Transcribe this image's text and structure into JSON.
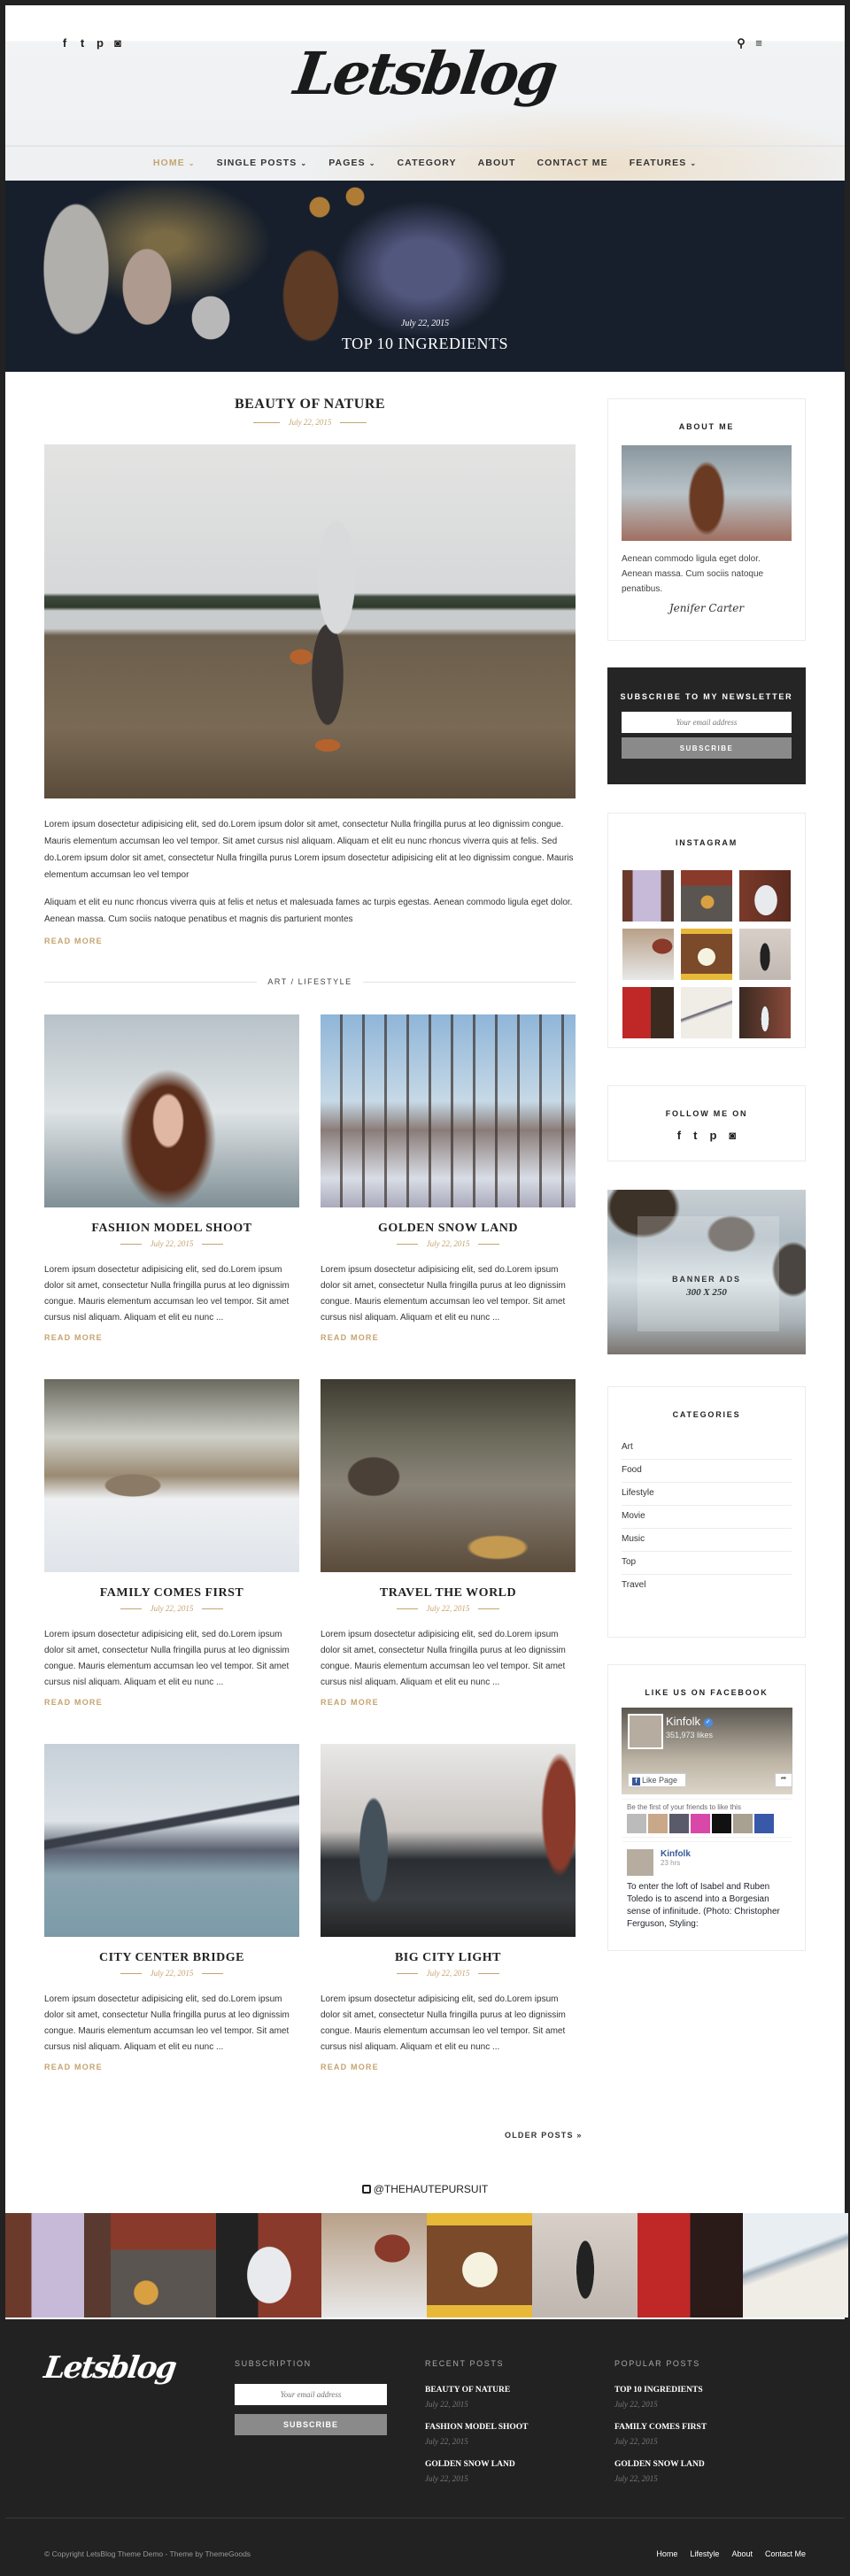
{
  "header": {
    "logo": "Letsblog",
    "social": [
      {
        "icon": "facebook-icon",
        "glyph": "f"
      },
      {
        "icon": "twitter-icon",
        "glyph": "t"
      },
      {
        "icon": "pinterest-icon",
        "glyph": "p"
      },
      {
        "icon": "instagram-icon",
        "glyph": "◙"
      }
    ],
    "search_glyph": "⚲",
    "menu_glyph": "≡",
    "nav": [
      {
        "label": "HOME",
        "dropdown": true,
        "active": true
      },
      {
        "label": "SINGLE POSTS",
        "dropdown": true
      },
      {
        "label": "PAGES",
        "dropdown": true
      },
      {
        "label": "CATEGORY",
        "dropdown": false
      },
      {
        "label": "ABOUT",
        "dropdown": false
      },
      {
        "label": "CONTACT ME",
        "dropdown": false
      },
      {
        "label": "FEATURES",
        "dropdown": true
      }
    ],
    "caret": "⌄"
  },
  "hero": {
    "date": "July 22, 2015",
    "title": "TOP 10 INGREDIENTS"
  },
  "featured": {
    "title": "BEAUTY OF NATURE",
    "date": "July 22, 2015",
    "paragraphs": [
      "Lorem ipsum dosectetur adipisicing elit, sed do.Lorem ipsum dolor sit amet, consectetur Nulla fringilla purus at leo dignissim congue. Mauris elementum accumsan leo vel tempor. Sit amet cursus nisl aliquam. Aliquam et elit eu nunc rhoncus viverra quis at felis. Sed do.Lorem ipsum dolor sit amet, consectetur Nulla fringilla purus Lorem ipsum dosectetur adipisicing elit at leo dignissim congue. Mauris elementum accumsan leo vel tempor",
      "Aliquam et elit eu nunc rhoncus viverra quis at felis et netus et malesuada fames ac turpis egestas. Aenean commodo ligula eget dolor. Aenean massa. Cum sociis natoque penatibus et magnis dis parturient montes"
    ],
    "read_more": "READ MORE",
    "categories": "ART  / LIFESTYLE"
  },
  "posts": [
    {
      "title": "FASHION MODEL SHOOT",
      "date": "July 22, 2015",
      "excerpt": "Lorem ipsum dosectetur adipisicing elit, sed do.Lorem ipsum dolor sit amet, consectetur Nulla fringilla purus at leo dignissim congue. Mauris elementum accumsan leo vel tempor. Sit amet cursus nisl aliquam. Aliquam et elit eu nunc ...",
      "read_more": "READ MORE"
    },
    {
      "title": "GOLDEN SNOW LAND",
      "date": "July 22, 2015",
      "excerpt": "Lorem ipsum dosectetur adipisicing elit, sed do.Lorem ipsum dolor sit amet, consectetur Nulla fringilla purus at leo dignissim congue. Mauris elementum accumsan leo vel tempor. Sit amet cursus nisl aliquam. Aliquam et elit eu nunc ...",
      "read_more": "READ MORE"
    },
    {
      "title": "FAMILY COMES FIRST",
      "date": "July 22, 2015",
      "excerpt": "Lorem ipsum dosectetur adipisicing elit, sed do.Lorem ipsum dolor sit amet, consectetur Nulla fringilla purus at leo dignissim congue. Mauris elementum accumsan leo vel tempor. Sit amet cursus nisl aliquam. Aliquam et elit eu nunc ...",
      "read_more": "READ MORE"
    },
    {
      "title": "TRAVEL THE WORLD",
      "date": "July 22, 2015",
      "excerpt": "Lorem ipsum dosectetur adipisicing elit, sed do.Lorem ipsum dolor sit amet, consectetur Nulla fringilla purus at leo dignissim congue. Mauris elementum accumsan leo vel tempor. Sit amet cursus nisl aliquam. Aliquam et elit eu nunc ...",
      "read_more": "READ MORE"
    },
    {
      "title": "CITY CENTER BRIDGE",
      "date": "July 22, 2015",
      "excerpt": "Lorem ipsum dosectetur adipisicing elit, sed do.Lorem ipsum dolor sit amet, consectetur Nulla fringilla purus at leo dignissim congue. Mauris elementum accumsan leo vel tempor. Sit amet cursus nisl aliquam. Aliquam et elit eu nunc ...",
      "read_more": "READ MORE"
    },
    {
      "title": "BIG CITY LIGHT",
      "date": "July 22, 2015",
      "excerpt": "Lorem ipsum dosectetur adipisicing elit, sed do.Lorem ipsum dolor sit amet, consectetur Nulla fringilla purus at leo dignissim congue. Mauris elementum accumsan leo vel tempor. Sit amet cursus nisl aliquam. Aliquam et elit eu nunc ...",
      "read_more": "READ MORE"
    }
  ],
  "pagination": {
    "older": "OLDER POSTS »"
  },
  "sidebar": {
    "about": {
      "title": "ABOUT ME",
      "text": "Aenean commodo ligula eget dolor. Aenean massa. Cum sociis natoque penatibus.",
      "signature": "Jenifer Carter"
    },
    "newsletter": {
      "title": "SUBSCRIBE TO MY NEWSLETTER",
      "placeholder": "Your email address",
      "button": "SUBSCRIBE"
    },
    "instagram": {
      "title": "INSTAGRAM"
    },
    "follow": {
      "title": "FOLLOW ME ON",
      "icons": [
        {
          "icon": "facebook-icon",
          "glyph": "f"
        },
        {
          "icon": "twitter-icon",
          "glyph": "t"
        },
        {
          "icon": "pinterest-icon",
          "glyph": "p"
        },
        {
          "icon": "instagram-icon",
          "glyph": "◙"
        }
      ]
    },
    "banner": {
      "label": "BANNER ADS",
      "size": "300 X 250"
    },
    "categories": {
      "title": "CATEGORIES",
      "items": [
        "Art",
        "Food",
        "Lifestyle",
        "Movie",
        "Music",
        "Top",
        "Travel"
      ]
    },
    "facebook": {
      "title": "LIKE US ON FACEBOOK",
      "page_name": "Kinfolk",
      "likes": "351,973 likes",
      "like_button": "Like Page",
      "friends_text": "Be the first of your friends to like this",
      "post_name": "Kinfolk",
      "post_time": "23 hrs",
      "post_text": "To enter the loft of Isabel and Ruben Toledo is to ascend into a Borgesian sense of infinitude. (Photo: Christopher Ferguson, Styling:"
    }
  },
  "instagram_strip": {
    "handle": "@THEHAUTEPURSUIT"
  },
  "footer": {
    "logo": "Letsblog",
    "subscription": {
      "title": "SUBSCRIPTION",
      "placeholder": "Your email address",
      "button": "SUBSCRIBE"
    },
    "recent": {
      "title": "RECENT POSTS",
      "items": [
        {
          "title": "BEAUTY OF NATURE",
          "date": "July 22, 2015"
        },
        {
          "title": "FASHION MODEL SHOOT",
          "date": "July 22, 2015"
        },
        {
          "title": "GOLDEN SNOW LAND",
          "date": "July 22, 2015"
        }
      ]
    },
    "popular": {
      "title": "POPULAR POSTS",
      "items": [
        {
          "title": "TOP 10 INGREDIENTS",
          "date": "July 22, 2015"
        },
        {
          "title": "FAMILY COMES FIRST",
          "date": "July 22, 2015"
        },
        {
          "title": "GOLDEN SNOW LAND",
          "date": "July 22, 2015"
        }
      ]
    },
    "copyright": "© Copyright LetsBlog Theme Demo - Theme by ThemeGoods",
    "links": [
      "Home",
      "Lifestyle",
      "About",
      "Contact Me"
    ]
  },
  "colors": {
    "accent": "#c5a370",
    "dark": "#222222",
    "footer_bg": "#222222",
    "button_gray": "#8a8a8a"
  }
}
